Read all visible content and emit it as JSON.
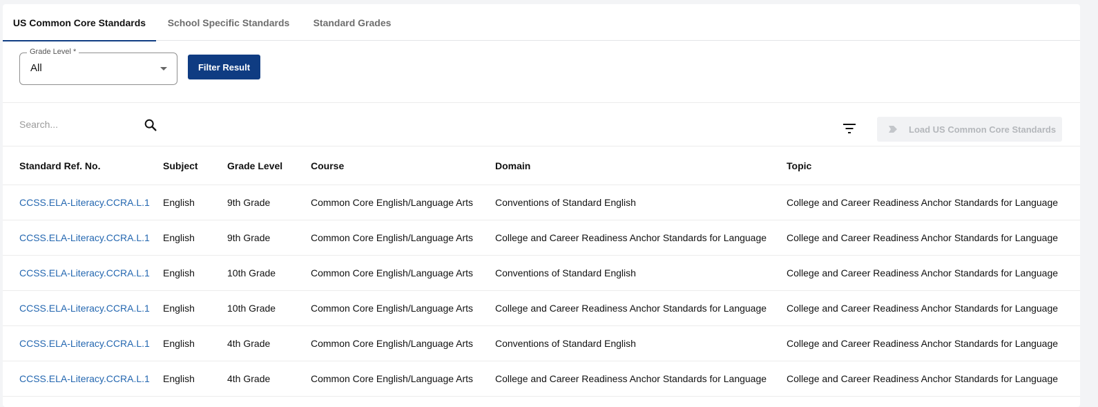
{
  "tabs": [
    {
      "label": "US Common Core Standards",
      "active": true
    },
    {
      "label": "School Specific Standards",
      "active": false
    },
    {
      "label": "Standard Grades",
      "active": false
    }
  ],
  "filter": {
    "grade_label": "Grade Level *",
    "grade_value": "All",
    "button_label": "Filter Result"
  },
  "search": {
    "placeholder": "Search...",
    "search_icon": "search-icon",
    "filter_icon": "filter-list-icon"
  },
  "load_button": {
    "label": "Load US Common Core Standards",
    "icon": "arrow-tag-icon",
    "disabled": true
  },
  "colors": {
    "accent": "#0f3c82",
    "link": "#2467b0"
  },
  "table": {
    "headers": [
      "Standard Ref. No.",
      "Subject",
      "Grade Level",
      "Course",
      "Domain",
      "Topic"
    ],
    "rows": [
      [
        "CCSS.ELA-Literacy.CCRA.L.1",
        "English",
        "9th Grade",
        "Common Core English/Language Arts",
        "Conventions of Standard English",
        "College and Career Readiness Anchor Standards for Language"
      ],
      [
        "CCSS.ELA-Literacy.CCRA.L.1",
        "English",
        "9th Grade",
        "Common Core English/Language Arts",
        "College and Career Readiness Anchor Standards for Language",
        "College and Career Readiness Anchor Standards for Language"
      ],
      [
        "CCSS.ELA-Literacy.CCRA.L.1",
        "English",
        "10th Grade",
        "Common Core English/Language Arts",
        "Conventions of Standard English",
        "College and Career Readiness Anchor Standards for Language"
      ],
      [
        "CCSS.ELA-Literacy.CCRA.L.1",
        "English",
        "10th Grade",
        "Common Core English/Language Arts",
        "College and Career Readiness Anchor Standards for Language",
        "College and Career Readiness Anchor Standards for Language"
      ],
      [
        "CCSS.ELA-Literacy.CCRA.L.1",
        "English",
        "4th Grade",
        "Common Core English/Language Arts",
        "Conventions of Standard English",
        "College and Career Readiness Anchor Standards for Language"
      ],
      [
        "CCSS.ELA-Literacy.CCRA.L.1",
        "English",
        "4th Grade",
        "Common Core English/Language Arts",
        "College and Career Readiness Anchor Standards for Language",
        "College and Career Readiness Anchor Standards for Language"
      ]
    ]
  }
}
